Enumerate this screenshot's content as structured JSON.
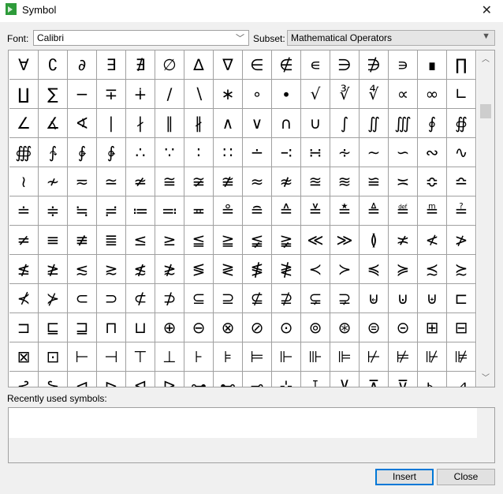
{
  "window": {
    "title": "Symbol",
    "close_glyph": "✕"
  },
  "font": {
    "label": "Font:",
    "value": "Calibri"
  },
  "subset": {
    "label": "Subset:",
    "value": "Mathematical Operators"
  },
  "grid": {
    "rows": [
      "∀∁∂∃∄∅∆∇∈∉∊∋∌∍∎∏",
      "∐∑−∓∔∕∖∗∘∙√∛∜∝∞∟",
      "∠∡∢∣∤∥∦∧∨∩∪∫∬∭∮∯",
      "∰∱∲∳∴∵∶∷∸∹∺∻∼∽∾∿",
      "≀≁≂≃≄≅≆≇≈≉≊≋≌≍≎≏",
      "≐≑≒≓≔≕≖≗≘≙≚≛≜≝≞≟",
      "≠≡≢≣≤≥≦≧≨≩≪≫≬≭≮≯",
      "≰≱≲≳≴≵≶≷≸≹≺≻≼≽≾≿",
      "⊀⊁⊂⊃⊄⊅⊆⊇⊈⊉⊊⊋⊌⊍⊎⊏",
      "⊐⊑⊒⊓⊔⊕⊖⊗⊘⊙⊚⊛⊜⊝⊞⊟",
      "⊠⊡⊢⊣⊤⊥⊦⊧⊨⊩⊪⊫⊬⊭⊮⊯",
      "⊰⊱⊲⊳⊴⊵⊶⊷⊸⊹⊺⊻⊼⊽⊾⊿"
    ]
  },
  "recent": {
    "label": "Recently used symbols:"
  },
  "buttons": {
    "insert": "Insert",
    "close": "Close"
  },
  "colors": {
    "accent": "#0078d7",
    "app_icon": "#2e9b3a"
  }
}
